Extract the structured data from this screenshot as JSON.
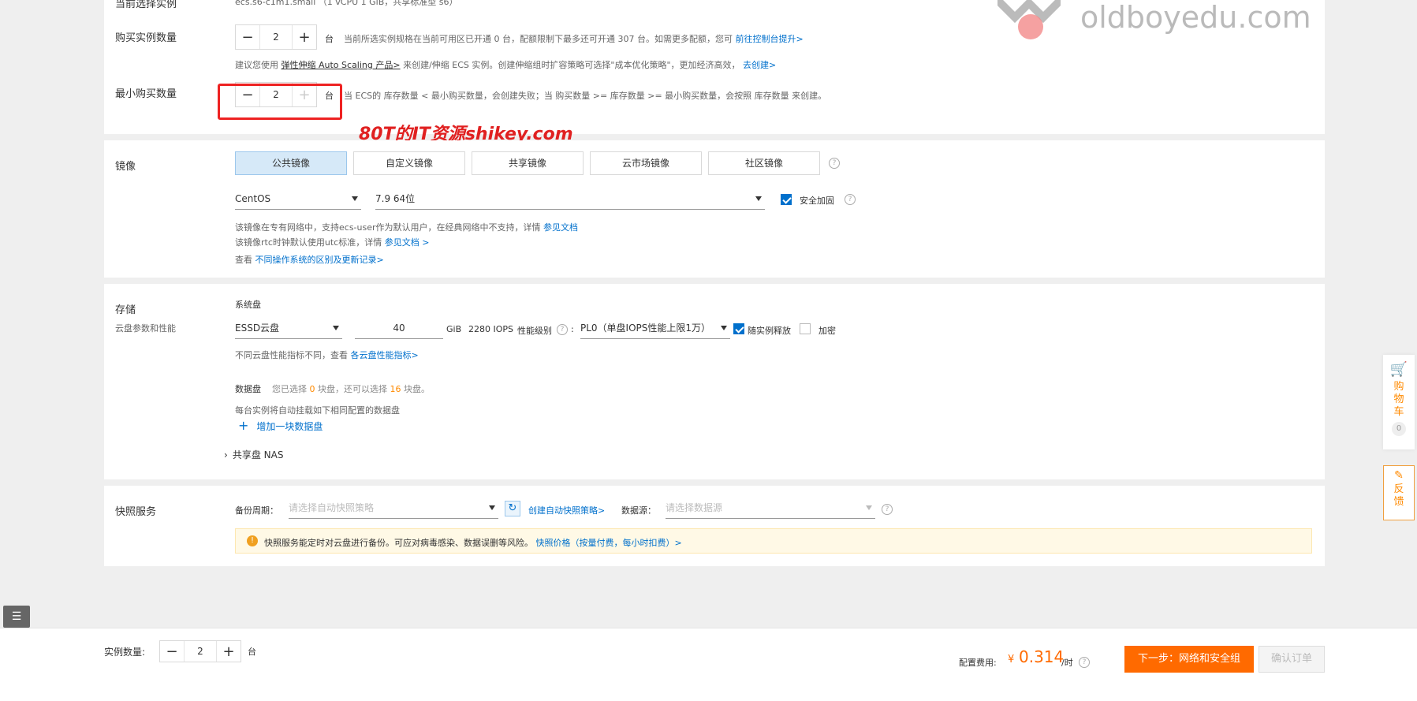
{
  "watermark": {
    "brand": "oldboyedu.com",
    "shikey": "80T的IT资源shikey.com"
  },
  "instances": {
    "current_selection_label": "当前选择实例",
    "current_selection_value": "ecs.s6-c1m1.small （1 vCPU 1 GiB，共享标准型 s6）",
    "buy_label": "购买实例数量",
    "buy_count": "2",
    "unit": "台",
    "buy_tip": "当前所选实例规格在当前可用区已开通 0 台，配额限制下最多还可开通 307 台。如需更多配额，您可",
    "buy_tip_link": "前往控制台提升>",
    "scaling_tip_prefix": "建议您使用",
    "scaling_link": "弹性伸缩 Auto Scaling 产品>",
    "scaling_tip_mid": "来创建/伸缩 ECS 实例。创建伸缩组时扩容策略可选择\"成本优化策略\"，更加经济高效，",
    "scaling_create_link": "去创建>",
    "min_label": "最小购买数量",
    "min_count": "2",
    "min_tip": "当 ECS的 库存数量 < 最小购买数量，会创建失败；当 购买数量 >= 库存数量 >= 最小购买数量，会按照 库存数量 来创建。"
  },
  "image": {
    "label": "镜像",
    "tabs": [
      "公共镜像",
      "自定义镜像",
      "共享镜像",
      "云市场镜像",
      "社区镜像"
    ],
    "os": "CentOS",
    "version": "7.9 64位",
    "security_label": "安全加固",
    "note1_prefix": "该镜像在专有网络中，支持ecs-user作为默认用户，在经典网络中不支持，详情",
    "note1_link": "参见文档",
    "note2_prefix": "该镜像rtc时钟默认使用utc标准，详情",
    "note2_link": "参见文档 >",
    "note3_prefix": "查看",
    "note3_link": "不同操作系统的区别及更新记录>"
  },
  "storage": {
    "label": "存储",
    "sub_label": "云盘参数和性能",
    "system_disk_label": "系统盘",
    "disk_type": "ESSD云盘",
    "size": "40",
    "size_unit": "GiB",
    "iops": "2280 IOPS",
    "perf_label": "性能级别",
    "perf_colon": ":",
    "perf_value": "PL0（单盘IOPS性能上限1万）",
    "release_label": "随实例释放",
    "encrypt_label": "加密",
    "perf_note_prefix": "不同云盘性能指标不同，查看",
    "perf_note_link": "各云盘性能指标>",
    "data_disk_label": "数据盘",
    "data_disk_text1": "您已选择",
    "data_disk_selected": "0",
    "data_disk_text2": "块盘，还可以选择",
    "data_disk_remaining": "16",
    "data_disk_text3": "块盘。",
    "data_disk_note": "每台实例将自动挂载如下相同配置的数据盘",
    "add_disk": "增加一块数据盘",
    "nas_label": "共享盘 NAS"
  },
  "snapshot": {
    "label": "快照服务",
    "period_label": "备份周期：",
    "period_placeholder": "请选择自动快照策略",
    "create_link": "创建自动快照策略>",
    "source_label": "数据源：",
    "source_placeholder": "请选择数据源",
    "notice": "快照服务能定时对云盘进行备份。可应对病毒感染、数据误删等风险。",
    "notice_link": "快照价格（按量付费，每小时扣费）>"
  },
  "side": {
    "cart": "购物车",
    "cart_count": "0",
    "feedback": "反馈"
  },
  "footer": {
    "count_label": "实例数量:",
    "count": "2",
    "unit": "台",
    "price_label": "配置费用:",
    "currency": "¥",
    "price": "0.314",
    "per": "/时",
    "next_button": "下一步：网络和安全组",
    "confirm_button": "确认订单"
  },
  "colors": {
    "accent": "#ff6a00",
    "link": "#0070cc",
    "highlight_box": "#ee2222",
    "active_tab": "#d6e9f8"
  }
}
